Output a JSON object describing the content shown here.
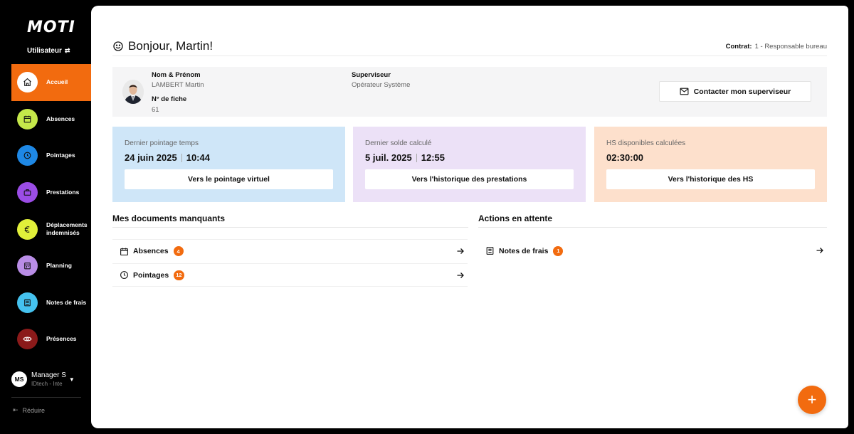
{
  "app": {
    "logo_text": "MOTI",
    "role_label": "Utilisateur"
  },
  "colors": {
    "accent": "#f26b0f",
    "sidebar_bg": "#000000"
  },
  "sidebar": {
    "items": [
      {
        "label": "Accueil",
        "icon": "home-icon",
        "color": "#ffffff",
        "active": true
      },
      {
        "label": "Absences",
        "icon": "calendar-icon",
        "color": "#c5e84a"
      },
      {
        "label": "Pointages",
        "icon": "clock-icon",
        "color": "#1e88e5"
      },
      {
        "label": "Prestations",
        "icon": "briefcase-icon",
        "color": "#9b4de6"
      },
      {
        "label": "Déplacements indemnisés",
        "icon": "euro-icon",
        "color": "#e1f03a"
      },
      {
        "label": "Planning",
        "icon": "planning-icon",
        "color": "#b98de6"
      },
      {
        "label": "Notes de frais",
        "icon": "receipt-icon",
        "color": "#45c2ef"
      },
      {
        "label": "Présences",
        "icon": "eye-icon",
        "color": "#8b1a1a"
      }
    ],
    "user": {
      "initials": "MS",
      "name": "Manager S",
      "org": "IDtech - Inte"
    },
    "reduce_label": "Réduire"
  },
  "header": {
    "greeting": "Bonjour, Martin!",
    "contract_label": "Contrat:",
    "contract_value": "1 - Responsable bureau"
  },
  "profile": {
    "name_label": "Nom & Prénom",
    "name_value": "LAMBERT Martin",
    "file_label": "N° de fiche",
    "file_value": "61",
    "supervisor_label": "Superviseur",
    "supervisor_value": "Opérateur Système",
    "contact_button": "Contacter mon superviseur"
  },
  "cards": [
    {
      "title": "Dernier pointage temps",
      "date": "24 juin 2025",
      "time": "10:44",
      "button": "Vers le pointage virtuel"
    },
    {
      "title": "Dernier solde calculé",
      "date": "5 juil. 2025",
      "time": "12:55",
      "button": "Vers l'historique des prestations"
    },
    {
      "title": "HS disponibles calculées",
      "value": "02:30:00",
      "button": "Vers l'historique des HS"
    }
  ],
  "missing_docs": {
    "title": "Mes documents manquants",
    "items": [
      {
        "label": "Absences",
        "count": "4",
        "icon": "calendar-icon"
      },
      {
        "label": "Pointages",
        "count": "12",
        "icon": "clock-icon"
      }
    ]
  },
  "pending_actions": {
    "title": "Actions en attente",
    "items": [
      {
        "label": "Notes de frais",
        "count": "1",
        "icon": "receipt-icon"
      }
    ]
  },
  "fab": {
    "symbol": "+"
  }
}
